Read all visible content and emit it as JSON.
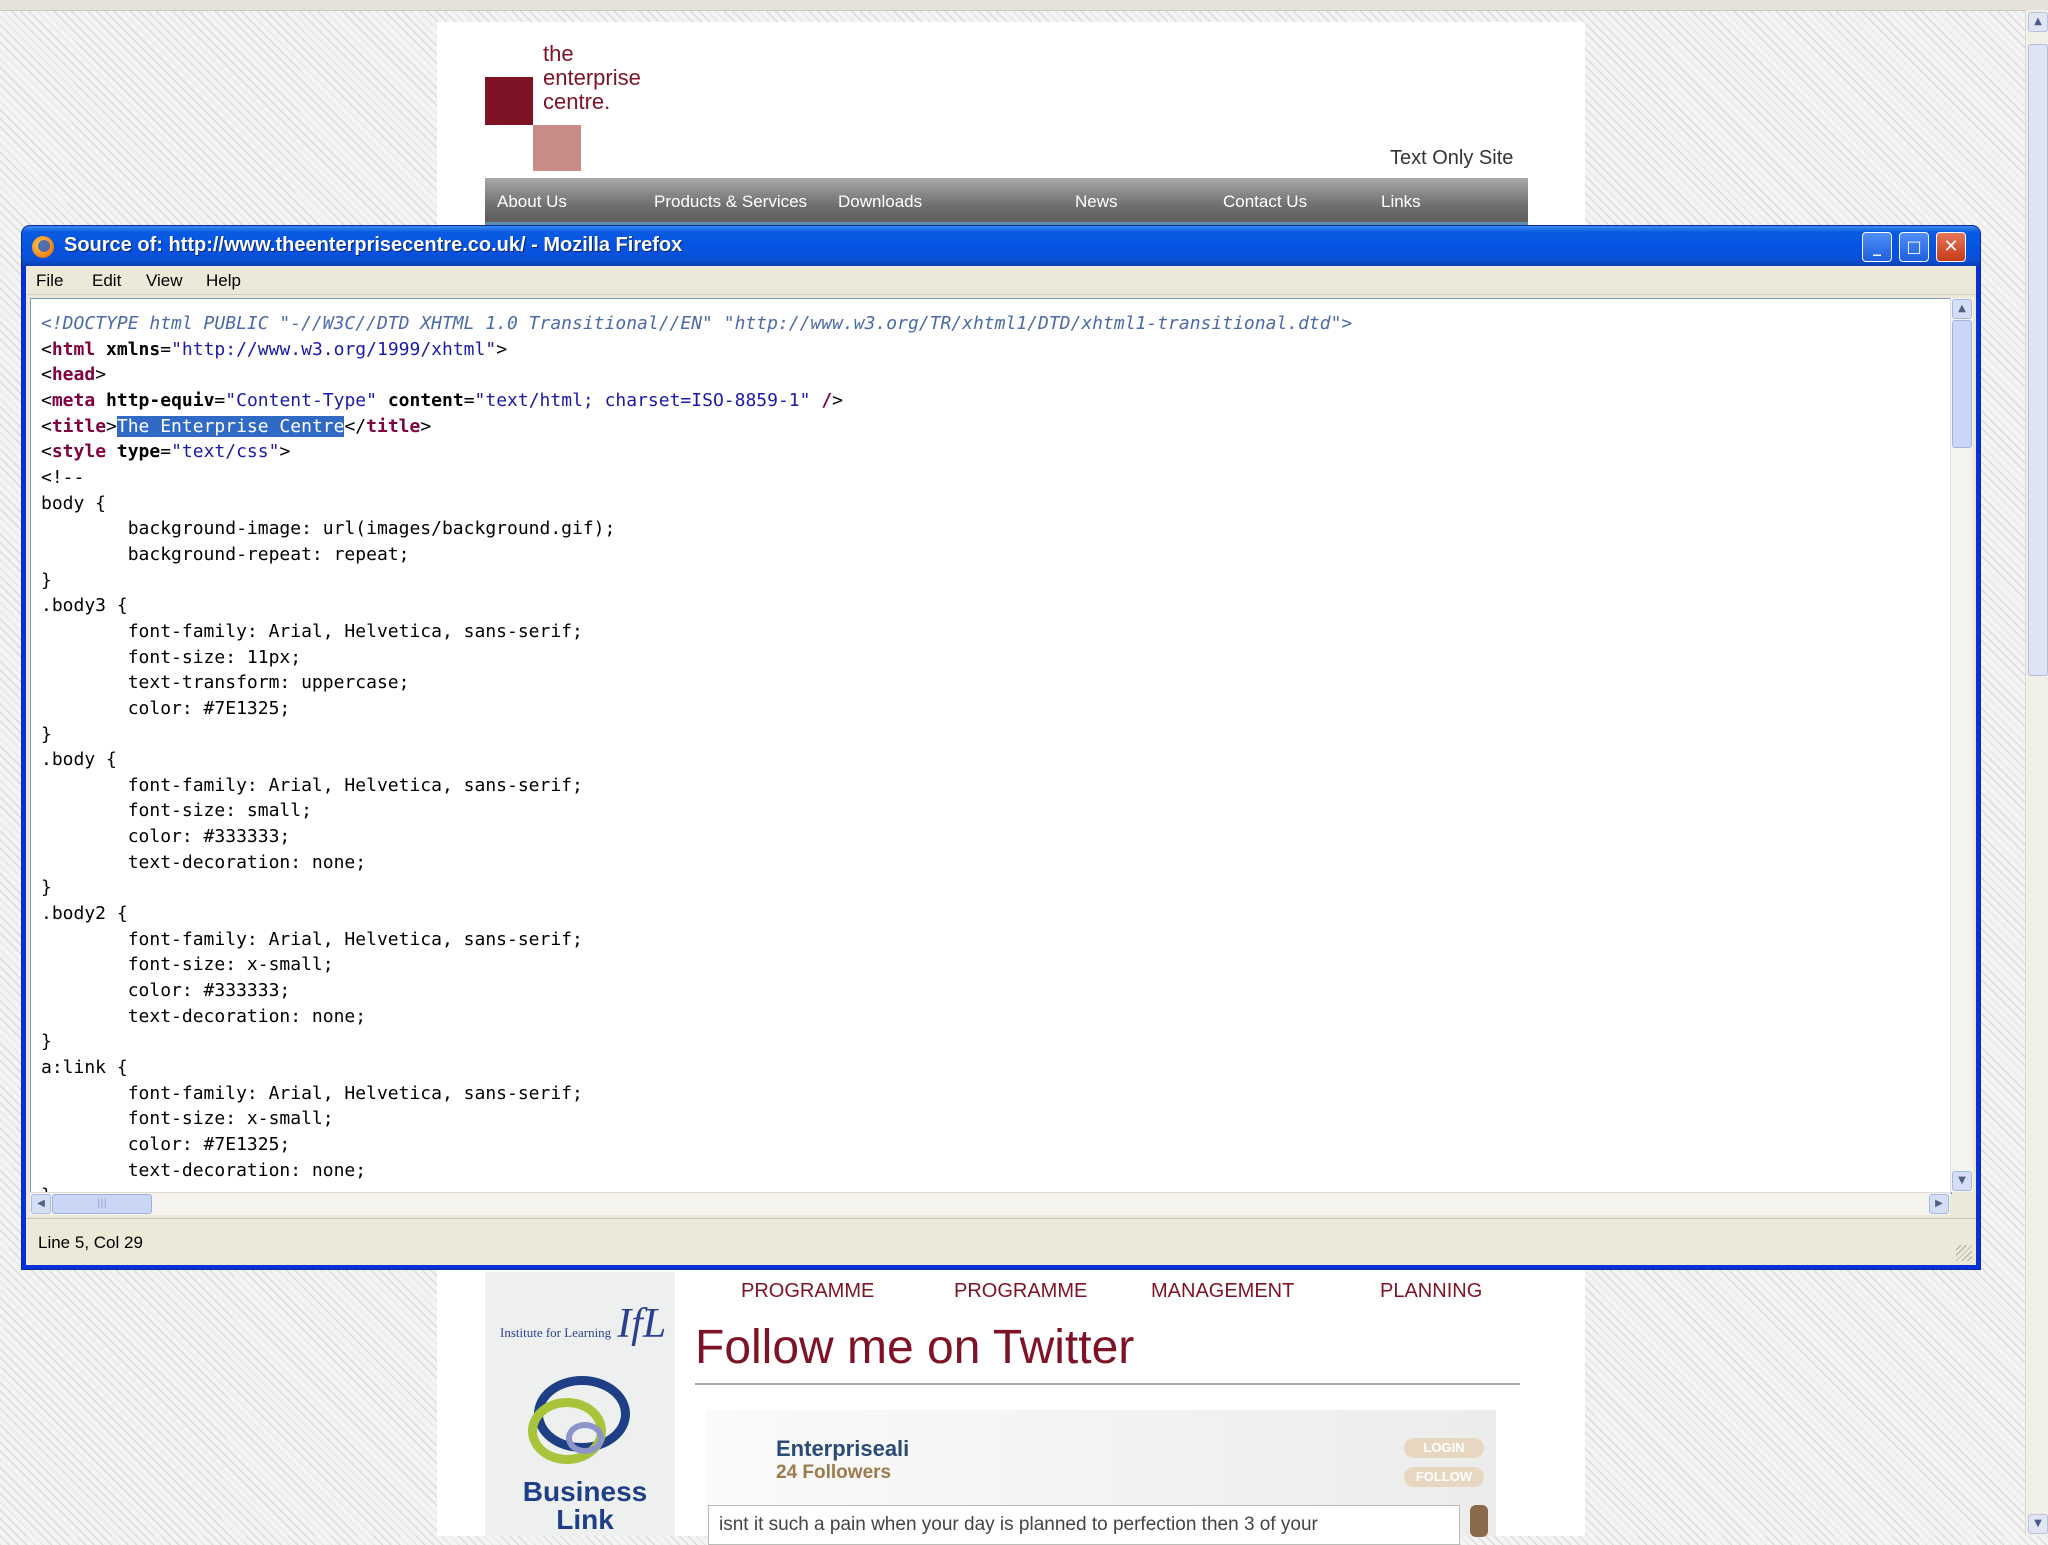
{
  "site": {
    "logo_lines": [
      "the",
      "enterprise",
      "centre."
    ],
    "text_only_link": "Text Only Site",
    "nav": [
      "About Us",
      "Products & Services",
      "Downloads",
      "News",
      "Contact Us",
      "Links"
    ],
    "programmes": [
      "PROGRAMME",
      "PROGRAMME",
      "MANAGEMENT",
      "PLANNING"
    ],
    "ifl_small": "Institute for Learning",
    "ifl_big": "IfL",
    "business_link": [
      "Business",
      "Link"
    ],
    "twitter": {
      "heading": "Follow me on Twitter",
      "name": "Enterpriseali",
      "followers": "24 Followers",
      "login": "LOGIN",
      "follow": "FOLLOW",
      "tweet": "isnt it such a pain when your day is planned to perfection then 3 of your"
    }
  },
  "window": {
    "title": "Source of: http://www.theenterprisecentre.co.uk/ - Mozilla Firefox",
    "menu": [
      "File",
      "Edit",
      "View",
      "Help"
    ],
    "status": "Line 5, Col 29",
    "controls": {
      "minimize": "_",
      "maximize": "□",
      "close": "✕"
    }
  },
  "source": {
    "doctype": "<!DOCTYPE html PUBLIC \"-//W3C//DTD XHTML 1.0 Transitional//EN\" \"http://www.w3.org/TR/xhtml1/DTD/xhtml1-transitional.dtd\">",
    "xmlns": "\"http://www.w3.org/1999/xhtml\"",
    "meta_equiv": "\"Content-Type\"",
    "meta_content": "\"text/html; charset=ISO-8859-1\"",
    "title_text": "The Enterprise Centre",
    "style_type": "\"text/css\"",
    "css_lines": [
      "<!--",
      "body {",
      "        background-image: url(images/background.gif);",
      "        background-repeat: repeat;",
      "}",
      ".body3 {",
      "        font-family: Arial, Helvetica, sans-serif;",
      "        font-size: 11px;",
      "        text-transform: uppercase;",
      "        color: #7E1325;",
      "}",
      ".body {",
      "        font-family: Arial, Helvetica, sans-serif;",
      "        font-size: small;",
      "        color: #333333;",
      "        text-decoration: none;",
      "}",
      ".body2 {",
      "        font-family: Arial, Helvetica, sans-serif;",
      "        font-size: x-small;",
      "        color: #333333;",
      "        text-decoration: none;",
      "}",
      "a:link {",
      "        font-family: Arial, Helvetica, sans-serif;",
      "        font-size: x-small;",
      "        color: #7E1325;",
      "        text-decoration: none;",
      "}"
    ]
  },
  "colors": {
    "brand": "#7E1325",
    "titlebar": "#0454E3",
    "selection": "#316AC5"
  }
}
